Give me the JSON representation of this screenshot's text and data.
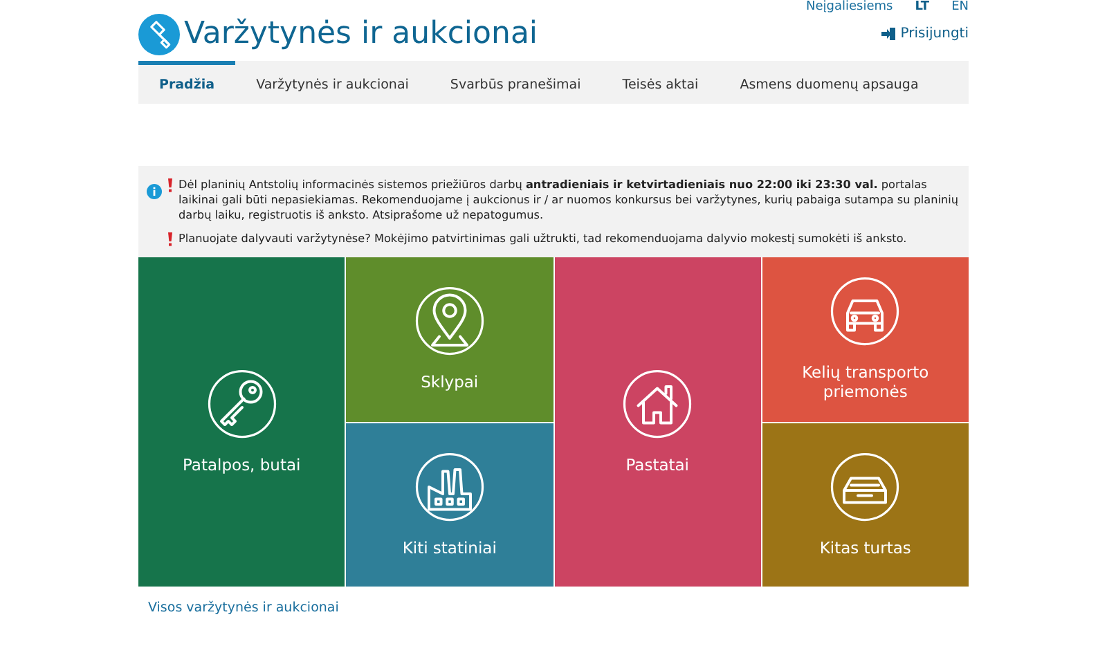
{
  "top_links": [
    {
      "label": "Neįgaliesiems",
      "selected": false
    },
    {
      "label": "LT",
      "selected": true
    },
    {
      "label": "EN",
      "selected": false
    }
  ],
  "header": {
    "title": "Varžytynės ir aukcionai",
    "login": "Prisijungti"
  },
  "tabs": [
    {
      "label": "Pradžia",
      "selected": true
    },
    {
      "label": "Varžytynės ir aukcionai",
      "selected": false
    },
    {
      "label": "Svarbūs pranešimai",
      "selected": false
    },
    {
      "label": "Teisės aktai",
      "selected": false
    },
    {
      "label": "Asmens duomenų apsauga",
      "selected": false
    }
  ],
  "notices": [
    "Dėl planinių Antstolių informacinės sistemos priežiūros darbų **antradieniais ir ketvirtadieniais nuo 22:00 iki 23:30 val.** portalas laikinai gali būti nepasiekiamas. Rekomenduojame į aukcionus ir / ar nuomos konkursus bei varžytynes, kurių pabaiga sutampa su planinių darbų laiku, registruotis iš anksto. Atsiprašome už nepatogumus.",
    "Planuojate dalyvauti varžytynėse? Mokėjimo patvirtinimas gali užtrukti, tad rekomenduojama dalyvio mokestį sumokėti iš anksto."
  ],
  "tile_columns": [
    {
      "tiles": [
        {
          "label": "Patalpos, butai",
          "kind": "key",
          "color": "#16744b"
        }
      ]
    },
    {
      "tiles": [
        {
          "label": "Sklypai",
          "kind": "pin",
          "color": "#5f8d2b"
        },
        {
          "label": "Kiti statiniai",
          "kind": "factory",
          "color": "#2f7f98"
        }
      ]
    },
    {
      "tiles": [
        {
          "label": "Pastatai",
          "kind": "house",
          "color": "#cc4462"
        }
      ]
    },
    {
      "tiles": [
        {
          "label": "Kelių transporto priemonės",
          "kind": "car",
          "color": "#dd5441"
        },
        {
          "label": "Kitas turtas",
          "kind": "tray",
          "color": "#9c7416"
        }
      ]
    }
  ],
  "all_link": "Visos varžytynės ir aukcionai"
}
